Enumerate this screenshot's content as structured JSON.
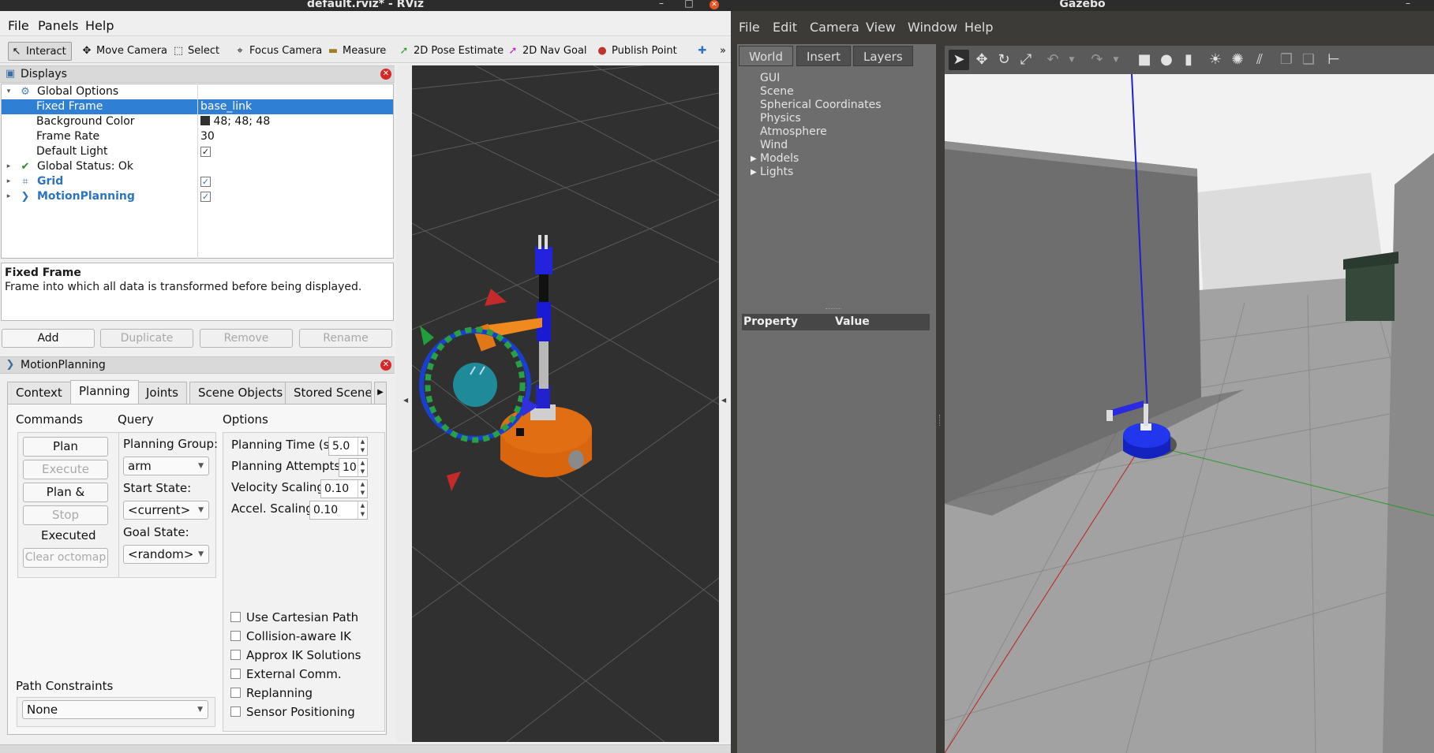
{
  "rviz": {
    "window_title": "default.rviz* - RViz",
    "menu": {
      "file": "File",
      "panels": "Panels",
      "help": "Help"
    },
    "toolbar": [
      "Interact",
      "Move Camera",
      "Select",
      "Focus Camera",
      "Measure",
      "2D Pose Estimate",
      "2D Nav Goal",
      "Publish Point"
    ],
    "displays": {
      "title": "Displays",
      "rows": [
        {
          "name": "Global Options",
          "value": ""
        },
        {
          "name": "Fixed Frame",
          "value": "base_link"
        },
        {
          "name": "Background Color",
          "value": "48; 48; 48"
        },
        {
          "name": "Frame Rate",
          "value": "30"
        },
        {
          "name": "Default Light",
          "value": "✓"
        },
        {
          "name": "Global Status: Ok",
          "value": ""
        },
        {
          "name": "Grid",
          "value": "✓"
        },
        {
          "name": "MotionPlanning",
          "value": "✓"
        }
      ],
      "description_title": "Fixed Frame",
      "description_text": "Frame into which all data is transformed before being displayed.",
      "buttons": [
        "Add",
        "Duplicate",
        "Remove",
        "Rename"
      ]
    },
    "motion_planning": {
      "title": "MotionPlanning",
      "tabs": [
        "Context",
        "Planning",
        "Joints",
        "Scene Objects",
        "Stored Scene"
      ],
      "commands": {
        "label": "Commands",
        "plan": "Plan",
        "execute": "Execute",
        "plan_execute": "Plan & Execute",
        "stop": "Stop",
        "status": "Executed",
        "clear_octomap": "Clear octomap"
      },
      "query": {
        "label": "Query",
        "planning_group_label": "Planning Group:",
        "planning_group": "arm",
        "start_state_label": "Start State:",
        "start_state": "<current>",
        "goal_state_label": "Goal State:",
        "goal_state": "<random>"
      },
      "options": {
        "label": "Options",
        "planning_time_label": "Planning Time (s):",
        "planning_time": "5.0",
        "planning_attempts_label": "Planning Attempts:",
        "planning_attempts": "10",
        "velocity_scaling_label": "Velocity Scaling:",
        "velocity_scaling": "0.10",
        "accel_scaling_label": "Accel. Scaling:",
        "accel_scaling": "0.10",
        "checkboxes": [
          "Use Cartesian Path",
          "Collision-aware IK",
          "Approx IK Solutions",
          "External Comm.",
          "Replanning",
          "Sensor Positioning"
        ]
      },
      "path_constraints_label": "Path Constraints",
      "path_constraints": "None"
    }
  },
  "gazebo": {
    "window_title": "Gazebo",
    "menu": [
      "File",
      "Edit",
      "Camera",
      "View",
      "Window",
      "Help"
    ],
    "tabs": [
      "World",
      "Insert",
      "Layers"
    ],
    "world_items": [
      "GUI",
      "Scene",
      "Spherical Coordinates",
      "Physics",
      "Atmosphere",
      "Wind",
      "Models",
      "Lights"
    ],
    "property_header": {
      "property": "Property",
      "value": "Value"
    },
    "toolbar_icons": [
      "select-icon",
      "translate-icon",
      "rotate-icon",
      "scale-icon",
      "undo-icon",
      "redo-icon",
      "box-icon",
      "sphere-icon",
      "cylinder-icon",
      "point-light-icon",
      "spot-light-icon",
      "directional-light-icon",
      "copy-icon",
      "paste-icon",
      "align-icon"
    ]
  },
  "colors": {
    "selection": "#2f7fd5",
    "rviz_bg": "#303030",
    "robot_orange": "#d9650f",
    "gazebo_robot": "#1a2de0"
  }
}
